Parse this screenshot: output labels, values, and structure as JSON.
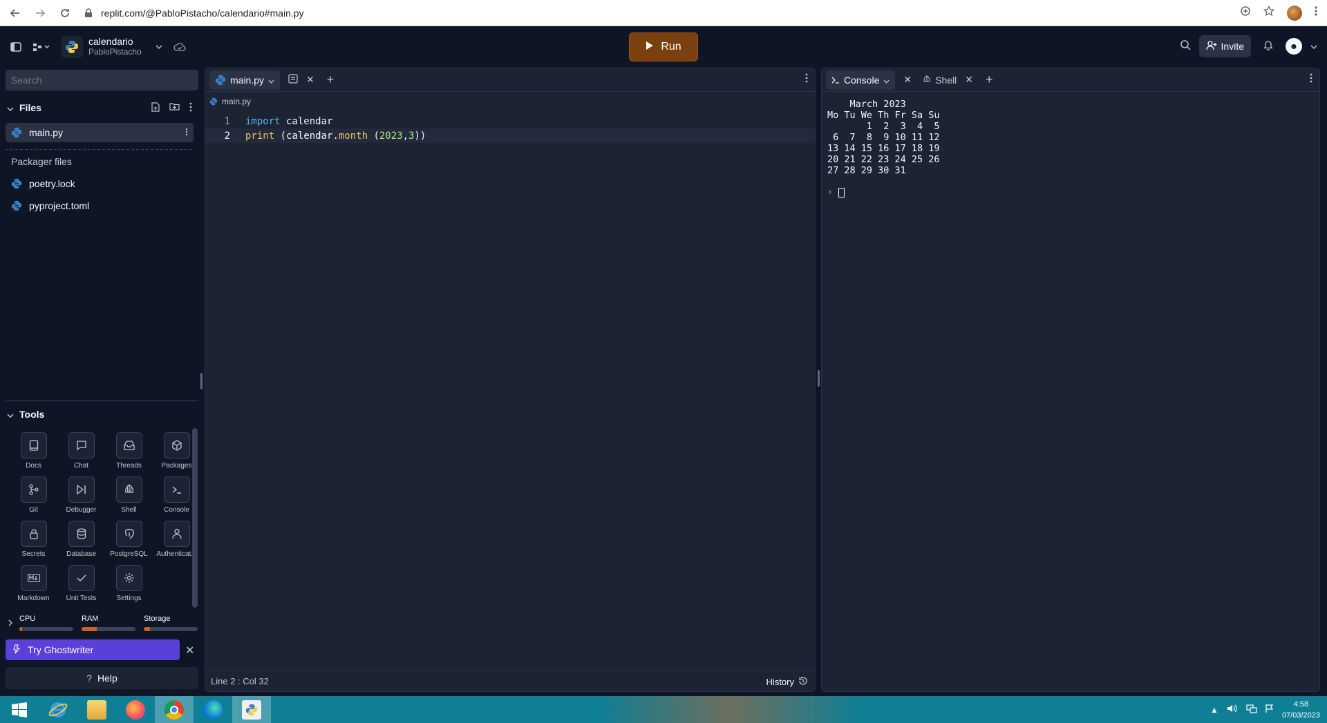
{
  "browser": {
    "url": "replit.com/@PabloPistacho/calendario#main.py"
  },
  "header": {
    "repl_title": "calendario",
    "repl_owner": "PabloPistacho",
    "run_label": "Run",
    "invite_label": "Invite"
  },
  "sidebar": {
    "search_placeholder": "Search",
    "files_title": "Files",
    "files": [
      {
        "name": "main.py"
      }
    ],
    "packager_title": "Packager files",
    "packager_files": [
      {
        "name": "poetry.lock"
      },
      {
        "name": "pyproject.toml"
      }
    ],
    "tools_title": "Tools",
    "tools": [
      {
        "label": "Docs",
        "icon": "book-icon"
      },
      {
        "label": "Chat",
        "icon": "chat-icon"
      },
      {
        "label": "Threads",
        "icon": "inbox-icon"
      },
      {
        "label": "Packages",
        "icon": "package-icon"
      },
      {
        "label": "Git",
        "icon": "git-icon"
      },
      {
        "label": "Debugger",
        "icon": "debugger-icon"
      },
      {
        "label": "Shell",
        "icon": "shell-icon"
      },
      {
        "label": "Console",
        "icon": "terminal-icon"
      },
      {
        "label": "Secrets",
        "icon": "lock-icon"
      },
      {
        "label": "Database",
        "icon": "database-icon"
      },
      {
        "label": "PostgreSQL",
        "icon": "postgres-icon"
      },
      {
        "label": "Authenticat...",
        "icon": "user-icon"
      },
      {
        "label": "Markdown",
        "icon": "markdown-icon"
      },
      {
        "label": "Unit Tests",
        "icon": "check-icon"
      },
      {
        "label": "Settings",
        "icon": "gear-icon"
      }
    ],
    "resources": [
      {
        "label": "CPU",
        "level": 0.05
      },
      {
        "label": "RAM",
        "level": 0.28
      },
      {
        "label": "Storage",
        "level": 0.12
      }
    ],
    "ghostwriter_label": "Try Ghostwriter",
    "help_label": "Help"
  },
  "editor": {
    "tab_label": "main.py",
    "breadcrumb": "main.py",
    "lines": [
      {
        "num": "1"
      },
      {
        "num": "2"
      }
    ],
    "status": "Line 2 : Col 32",
    "history_label": "History"
  },
  "console": {
    "tab_console": "Console",
    "tab_shell": "Shell",
    "output": "    March 2023\nMo Tu We Th Fr Sa Su\n       1  2  3  4  5\n 6  7  8  9 10 11 12\n13 14 15 16 17 18 19\n20 21 22 23 24 25 26\n27 28 29 30 31"
  },
  "taskbar": {
    "time": "4:58",
    "date": "07/03/2023"
  },
  "colors": {
    "run": "#7c3f0e",
    "ghostwriter": "#5b3fd9",
    "background": "#0e1525",
    "panel": "#1c2333"
  }
}
